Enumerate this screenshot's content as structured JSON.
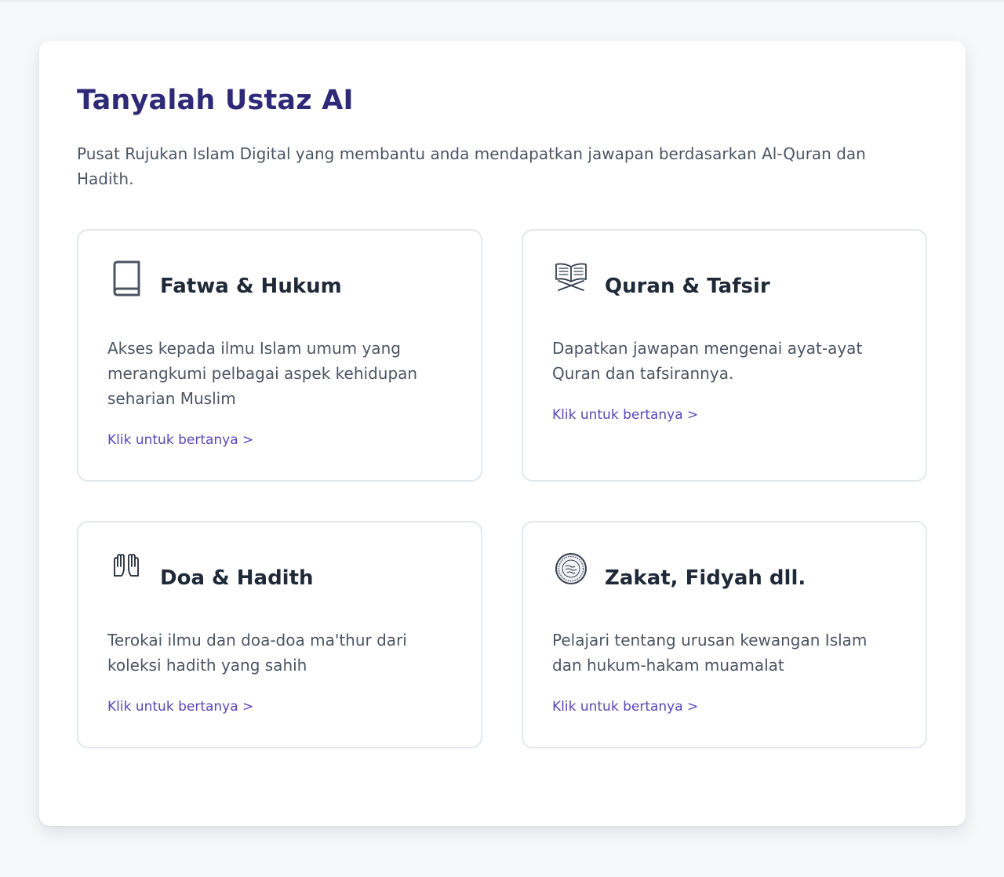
{
  "page": {
    "title": "Tanyalah Ustaz AI",
    "description": "Pusat Rujukan Islam Digital yang membantu anda mendapatkan jawapan berdasarkan Al-Quran dan Hadith."
  },
  "colors": {
    "title": "#2e2a78",
    "link": "#5b46b8",
    "card_border": "#e3e8ec",
    "background": "#f7f8fa"
  },
  "cards": [
    {
      "title": "Fatwa & Hukum",
      "icon": "book-icon",
      "description": "Akses kepada ilmu Islam umum yang merangkumi pelbagai aspek kehidupan seharian Muslim",
      "link": "Klik untuk bertanya >"
    },
    {
      "title": "Quran & Tafsir",
      "icon": "open-quran-icon",
      "description": "Dapatkan jawapan mengenai ayat-ayat Quran dan tafsirannya.",
      "link": "Klik untuk bertanya >"
    },
    {
      "title": "Doa & Hadith",
      "icon": "praying-hands-icon",
      "description": "Terokai ilmu dan doa-doa ma'thur dari koleksi hadith yang sahih",
      "link": "Klik untuk bertanya >"
    },
    {
      "title": "Zakat, Fidyah dll.",
      "icon": "coin-icon",
      "description": "Pelajari tentang urusan kewangan Islam dan hukum-hakam muamalat",
      "link": "Klik untuk bertanya >"
    }
  ]
}
